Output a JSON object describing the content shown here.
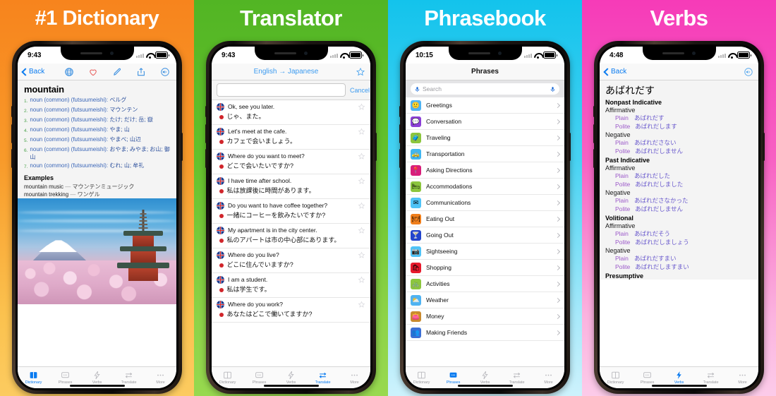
{
  "panels": [
    {
      "headline": "#1 Dictionary",
      "bg_top": "#F7841D",
      "bg_bottom": "#FCCB60",
      "status": {
        "time": "9:43"
      },
      "nav": {
        "back_label": "Back",
        "icons": [
          "globe-icon",
          "heart-icon",
          "pencil-icon",
          "share-icon",
          "speaker-icon"
        ]
      },
      "entry": {
        "word": "mountain",
        "senses": [
          {
            "num": "1.",
            "pos": "noun (common) (futsuumeishi):",
            "gloss": "ベルグ"
          },
          {
            "num": "2.",
            "pos": "noun (common) (futsuumeishi):",
            "gloss": "マウンテン"
          },
          {
            "num": "3.",
            "pos": "noun (common) (futsuumeishi):",
            "gloss": "たけ; だけ; 岳; 嶽"
          },
          {
            "num": "4.",
            "pos": "noun (common) (futsuumeishi):",
            "gloss": "やま; 山"
          },
          {
            "num": "5.",
            "pos": "noun (common) (futsuumeishi):",
            "gloss": "やまべ; 山辺"
          },
          {
            "num": "6.",
            "pos": "noun (common) (futsuumeishi):",
            "gloss": "おやま; みやま; お山; 御山"
          },
          {
            "num": "7.",
            "pos": "noun (common) (futsuumeishi):",
            "gloss": "むれ; 山; 牟礼"
          }
        ],
        "examples_heading": "Examples",
        "examples": [
          {
            "en": "mountain music",
            "jp": "マウンテンミュージック"
          },
          {
            "en": "mountain trekking",
            "jp": "ワンゲル"
          }
        ]
      },
      "photo_alt": "mount-fuji-pagoda-cherry-blossom-photo",
      "active_tab": "Dictionary"
    },
    {
      "headline": "Translator",
      "bg_top": "#52B524",
      "bg_bottom": "#98D94F",
      "status": {
        "time": "9:43"
      },
      "nav": {
        "title": "English → Japanese",
        "star": "star-icon"
      },
      "search": {
        "value": "",
        "cancel_label": "Cancel"
      },
      "rows": [
        {
          "en": "Ok, see you later.",
          "jp": "じゃ、また。"
        },
        {
          "en": "Let's meet at the cafe.",
          "jp": "カフェで会いましょう。"
        },
        {
          "en": "Where do you want to meet?",
          "jp": "どこで会いたいですか?"
        },
        {
          "en": "I have time after school.",
          "jp": "私は放課後に時間があります。"
        },
        {
          "en": "Do you want to have coffee together?",
          "jp": "一緒にコーヒーを飲みたいですか?"
        },
        {
          "en": "My apartment is in the city center.",
          "jp": "私のアパートは市の中心部にあります。"
        },
        {
          "en": "Where do you live?",
          "jp": "どこに住んでいますか?"
        },
        {
          "en": "I am a student.",
          "jp": "私は学生です。"
        },
        {
          "en": "Where do you work?",
          "jp": "あなたはどこで働いてますか?"
        }
      ],
      "active_tab": "Translate"
    },
    {
      "headline": "Phrasebook",
      "bg_top": "#13C3EC",
      "bg_bottom": "#CDF2FC",
      "status": {
        "time": "10:15"
      },
      "nav": {
        "title": "Phrases"
      },
      "search": {
        "placeholder": "Search",
        "mic": "microphone-icon"
      },
      "categories": [
        {
          "label": "Greetings",
          "glyph": "🙂",
          "color": "#4fb3f2"
        },
        {
          "label": "Conversation",
          "glyph": "💬",
          "color": "#8b3fd6"
        },
        {
          "label": "Traveling",
          "glyph": "🧳",
          "color": "#8cc63e"
        },
        {
          "label": "Transportation",
          "glyph": "🚕",
          "color": "#41b6f0"
        },
        {
          "label": "Asking Directions",
          "glyph": "📍",
          "color": "#d81e7a"
        },
        {
          "label": "Accommodations",
          "glyph": "🛏",
          "color": "#8cc63e"
        },
        {
          "label": "Communications",
          "glyph": "✉",
          "color": "#4fc3f7"
        },
        {
          "label": "Eating Out",
          "glyph": "🍽",
          "color": "#f07e1a"
        },
        {
          "label": "Going Out",
          "glyph": "🍸",
          "color": "#2244cc"
        },
        {
          "label": "Sightseeing",
          "glyph": "📷",
          "color": "#4fc3f7"
        },
        {
          "label": "Shopping",
          "glyph": "🛍",
          "color": "#e8192c"
        },
        {
          "label": "Activities",
          "glyph": "🚲",
          "color": "#8cc63e"
        },
        {
          "label": "Weather",
          "glyph": "⛅",
          "color": "#4fb3f2"
        },
        {
          "label": "Money",
          "glyph": "👛",
          "color": "#c98a2e"
        },
        {
          "label": "Making Friends",
          "glyph": "👥",
          "color": "#3b6fd4"
        }
      ],
      "active_tab": "Phrases"
    },
    {
      "headline": "Verbs",
      "bg_top": "#F63BB8",
      "bg_bottom": "#FCCBE9",
      "status": {
        "time": "4:48"
      },
      "nav": {
        "back_label": "Back",
        "icons": [
          "speaker-icon"
        ]
      },
      "verb": {
        "word": "あばれだす",
        "sections": [
          {
            "title": "Nonpast Indicative",
            "polarities": [
              {
                "name": "Affirmative",
                "forms": [
                  {
                    "label": "Plain",
                    "value": "あばれだす"
                  },
                  {
                    "label": "Polite",
                    "value": "あばれだします"
                  }
                ]
              },
              {
                "name": "Negative",
                "forms": [
                  {
                    "label": "Plain",
                    "value": "あばれださない"
                  },
                  {
                    "label": "Polite",
                    "value": "あばれだしません"
                  }
                ]
              }
            ]
          },
          {
            "title": "Past Indicative",
            "polarities": [
              {
                "name": "Affirmative",
                "forms": [
                  {
                    "label": "Plain",
                    "value": "あばれだした"
                  },
                  {
                    "label": "Polite",
                    "value": "あばれだしました"
                  }
                ]
              },
              {
                "name": "Negative",
                "forms": [
                  {
                    "label": "Plain",
                    "value": "あばれださなかった"
                  },
                  {
                    "label": "Polite",
                    "value": "あばれだしません"
                  }
                ]
              }
            ]
          },
          {
            "title": "Volitional",
            "polarities": [
              {
                "name": "Affirmative",
                "forms": [
                  {
                    "label": "Plain",
                    "value": "あばれだそう"
                  },
                  {
                    "label": "Polite",
                    "value": "あばれだしましょう"
                  }
                ]
              },
              {
                "name": "Negative",
                "forms": [
                  {
                    "label": "Plain",
                    "value": "あばれだすまい"
                  },
                  {
                    "label": "Polite",
                    "value": "あばれだしますまい"
                  }
                ]
              }
            ]
          },
          {
            "title": "Presumptive",
            "polarities": []
          }
        ]
      },
      "active_tab": "Verbs"
    }
  ],
  "tabbar": {
    "items": [
      {
        "label": "Dictionary",
        "icon": "book-icon"
      },
      {
        "label": "Phrases",
        "icon": "speech-bubble-icon"
      },
      {
        "label": "Verbs",
        "icon": "lightning-bolt-icon"
      },
      {
        "label": "Translate",
        "icon": "swap-arrows-icon"
      },
      {
        "label": "More",
        "icon": "ellipsis-icon"
      }
    ],
    "active_color": "#0a7bf0",
    "inactive_color": "#9a9a9f"
  }
}
